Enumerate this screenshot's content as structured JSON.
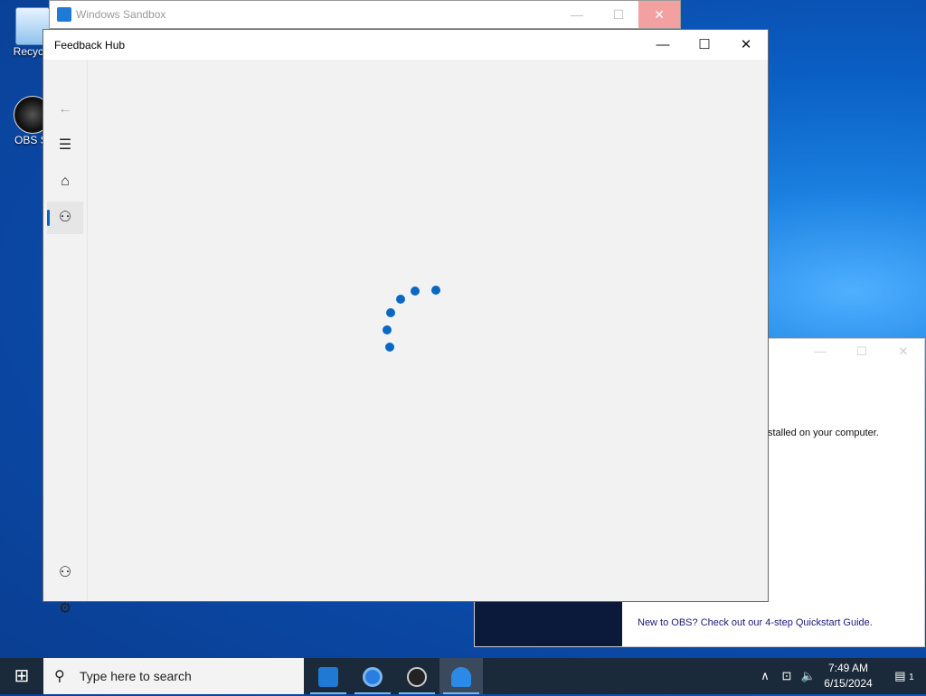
{
  "desktop": {
    "icons": [
      {
        "label": "Recycle",
        "icon": "recycle-bin-icon"
      },
      {
        "label": "OBS St",
        "icon": "obs-studio-icon"
      }
    ]
  },
  "sandbox": {
    "title": "Windows Sandbox",
    "min": "—",
    "max": "☐",
    "close": "✕"
  },
  "obs_dialog": {
    "message": "stalled on your computer.",
    "link": "New to OBS? Check out our 4-step Quickstart Guide.",
    "min": "—",
    "max": "☐",
    "close": "✕"
  },
  "feedback_hub": {
    "title": "Feedback Hub",
    "min": "—",
    "max": "☐",
    "close": "✕",
    "nav": [
      {
        "name": "back",
        "glyph": "←"
      },
      {
        "name": "menu",
        "glyph": "☰"
      },
      {
        "name": "home",
        "glyph": "⌂"
      },
      {
        "name": "feedback",
        "glyph": "⚇"
      },
      {
        "name": "add-account",
        "glyph": "⚇"
      },
      {
        "name": "settings",
        "glyph": "⚙"
      }
    ],
    "loading_color": "#0a68c4"
  },
  "taskbar": {
    "start_glyph": "⊞",
    "search_placeholder": "Type here to search",
    "search_glyph": "⚲",
    "apps": [
      {
        "name": "windows-sandbox-icon",
        "glyph": "◆"
      },
      {
        "name": "chrome-icon",
        "glyph": "◉"
      },
      {
        "name": "obs-icon",
        "glyph": "◎"
      },
      {
        "name": "feedback-hub-icon",
        "glyph": "●"
      }
    ],
    "tray": {
      "chevron": "∧",
      "network": "⊡",
      "volume": "🔈",
      "notif": "▤",
      "notif_count": "1"
    },
    "time": "7:49 AM",
    "date": "6/15/2024"
  }
}
